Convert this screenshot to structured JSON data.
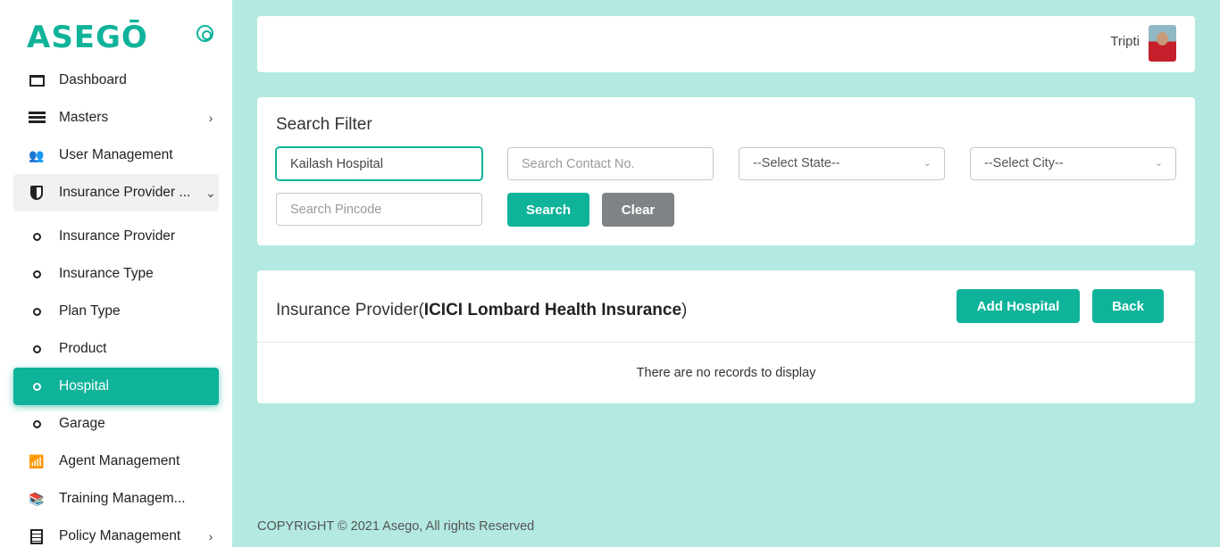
{
  "brand": {
    "name": "ASEGŌ"
  },
  "header": {
    "username": "Tripti"
  },
  "sidebar": {
    "items": [
      {
        "label": "Dashboard",
        "icon": "dashboard-icon"
      },
      {
        "label": "Masters",
        "icon": "list-icon",
        "chevron": "›"
      },
      {
        "label": "User Management",
        "icon": "users-icon"
      },
      {
        "label": "Insurance Provider ...",
        "icon": "shield-icon",
        "chevron": "⌄"
      },
      {
        "label": "Insurance Provider",
        "icon": "dot-icon"
      },
      {
        "label": "Insurance Type",
        "icon": "dot-icon"
      },
      {
        "label": "Plan Type",
        "icon": "dot-icon"
      },
      {
        "label": "Product",
        "icon": "dot-icon"
      },
      {
        "label": "Hospital",
        "icon": "dot-icon"
      },
      {
        "label": "Garage",
        "icon": "dot-icon"
      },
      {
        "label": "Agent Management",
        "icon": "agent-icon"
      },
      {
        "label": "Training Managem...",
        "icon": "training-icon"
      },
      {
        "label": "Policy Management",
        "icon": "policy-icon",
        "chevron": "›"
      }
    ]
  },
  "filter": {
    "title": "Search Filter",
    "hospital_name_value": "Kailash Hospital",
    "contact_placeholder": "Search Contact No.",
    "state_selected": "--Select State--",
    "city_selected": "--Select City--",
    "pincode_placeholder": "Search Pincode",
    "search_label": "Search",
    "clear_label": "Clear"
  },
  "table": {
    "title_prefix": "Insurance Provider(",
    "provider_name": "ICICI Lombard Health Insurance",
    "title_suffix": ")",
    "add_label": "Add Hospital",
    "back_label": "Back",
    "empty_message": "There are no records to display"
  },
  "footer": {
    "copyright": "COPYRIGHT © 2021 Asego, All rights Reserved"
  },
  "colors": {
    "accent": "#0fb39a",
    "background": "#b3e9e1",
    "clear_button": "#7f8386"
  }
}
